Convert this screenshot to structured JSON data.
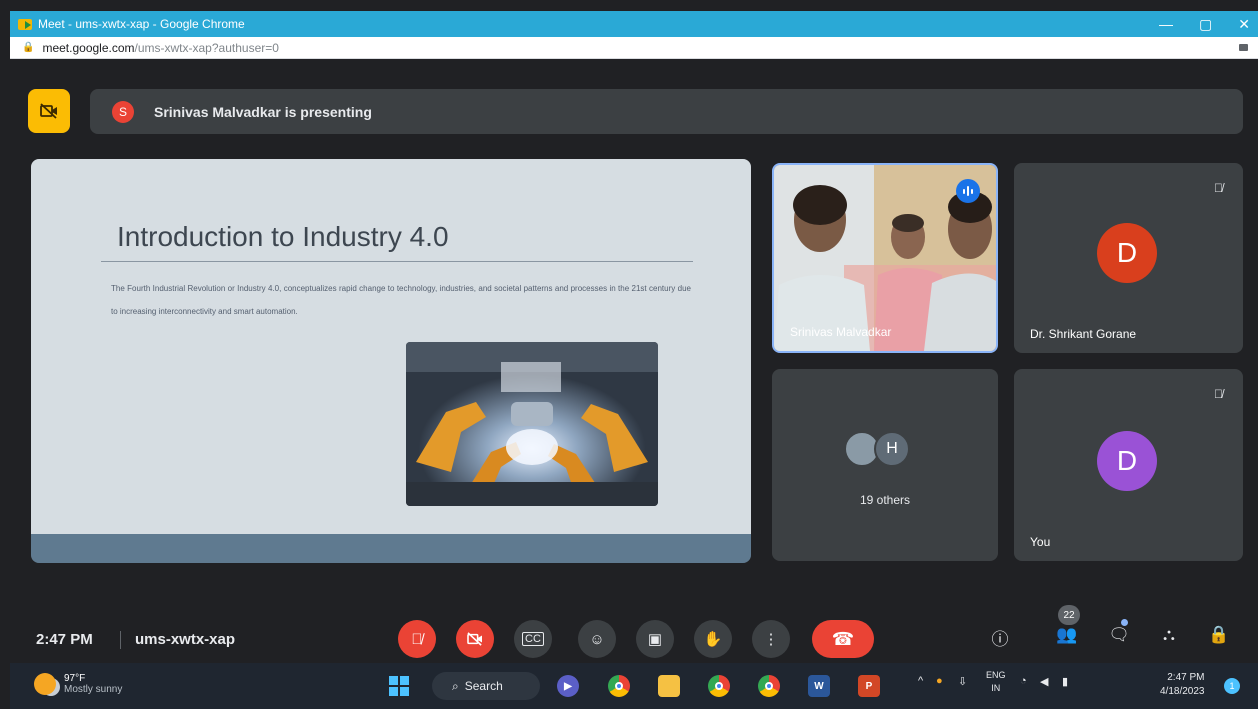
{
  "window": {
    "title": "Meet - ums-xwtx-xap - Google Chrome",
    "controls": {
      "minimize": "—",
      "maximize": "▢",
      "close": "✕"
    }
  },
  "address_bar": {
    "host": "meet.google.com",
    "path": "/ums-xwtx-xap?authuser=0"
  },
  "presentation_bar": {
    "avatar_letter": "S",
    "text": "Srinivas Malvadkar is presenting"
  },
  "slide": {
    "title": "Introduction to Industry 4.0",
    "body": "The Fourth Industrial Revolution or Industry 4.0, conceptualizes rapid change to technology, industries, and societal patterns and processes in the 21st century due to increasing interconnectivity and smart automation."
  },
  "tiles": {
    "srinivas": {
      "name": "Srinivas Malvadkar"
    },
    "shrikant": {
      "name": "Dr. Shrikant Gorane",
      "avatar_letter": "D",
      "avatar_color": "#d93f1d"
    },
    "others": {
      "avatar_letter": "H",
      "label": "19 others"
    },
    "you": {
      "name": "You",
      "avatar_letter": "D",
      "avatar_color": "#9a52d6"
    }
  },
  "bottom_bar": {
    "time": "2:47 PM",
    "meeting_code": "ums-xwtx-xap",
    "people_count": "22"
  },
  "taskbar": {
    "weather_temp": "97°F",
    "weather_desc": "Mostly sunny",
    "search_label": "Search",
    "language_line1": "ENG",
    "language_line2": "IN",
    "time": "2:47 PM",
    "date": "4/18/2023",
    "notification_count": "1"
  },
  "colors": {
    "meet_background": "#202124",
    "tile": "#3c4043",
    "danger": "#ea4335",
    "accent_blue": "#1a73e8",
    "camera_warning": "#fbbc04",
    "titlebar": "#2aa9d6"
  }
}
